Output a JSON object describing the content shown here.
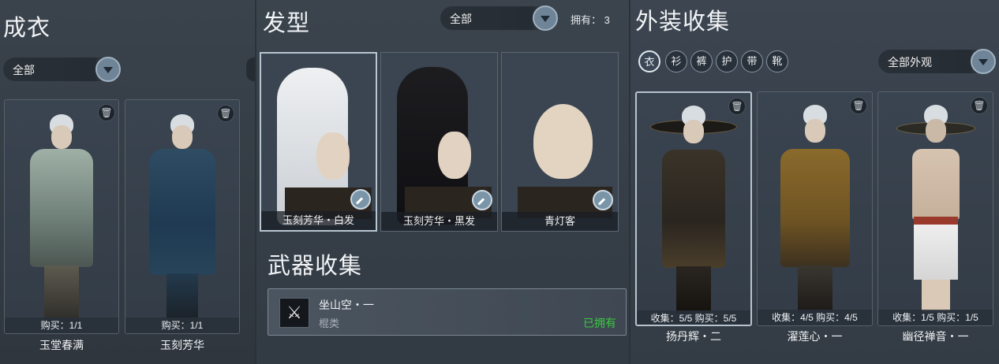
{
  "outfit": {
    "title": "成衣",
    "filter": "全部",
    "cards": [
      {
        "status": "购买：1/1",
        "name": "玉堂春满"
      },
      {
        "status": "购买：1/1",
        "name": "玉刻芳华"
      }
    ]
  },
  "hair": {
    "title": "发型",
    "filter": "全部",
    "owned": "拥有： 3",
    "cards": [
      {
        "name": "玉刻芳华・白发"
      },
      {
        "name": "玉刻芳华・黑发"
      },
      {
        "name": "青灯客"
      }
    ]
  },
  "weapon": {
    "title": "武器收集",
    "item": {
      "name": "坐山空・一",
      "type": "棍类",
      "status": "已拥有"
    }
  },
  "appearance": {
    "title": "外装收集",
    "filter": "全部外观",
    "categories": [
      "outfit-all-icon",
      "top-icon",
      "pants-icon",
      "gloves-icon",
      "belt-icon",
      "shoes-icon"
    ],
    "cards": [
      {
        "status": "收集：5/5  购买：5/5",
        "name": "扬丹辉・二"
      },
      {
        "status": "收集：4/5  购买：4/5",
        "name": "濯莲心・一"
      },
      {
        "status": "收集：1/5  购买：1/5",
        "name": "幽径禅音・一"
      }
    ]
  },
  "colors": {
    "owned_green": "#39c93f",
    "panel_bg": "#333b44"
  }
}
